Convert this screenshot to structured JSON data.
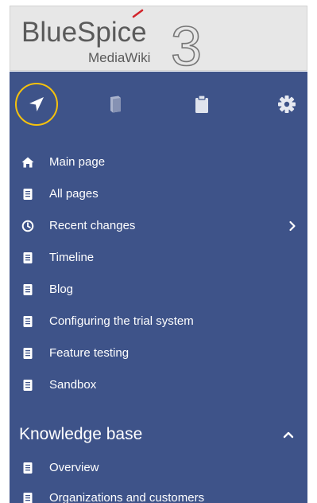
{
  "logo": {
    "brand": "BlueSpice",
    "version": "3",
    "sub": "MediaWiki"
  },
  "tabs": [
    {
      "name": "navigation",
      "icon": "location-arrow-icon",
      "active": true
    },
    {
      "name": "books",
      "icon": "book-icon",
      "active": false
    },
    {
      "name": "clipboard",
      "icon": "clipboard-icon",
      "active": false
    },
    {
      "name": "settings",
      "icon": "gear-icon",
      "active": false
    }
  ],
  "nav": {
    "items": [
      {
        "label": "Main page",
        "icon": "home-icon"
      },
      {
        "label": "All pages",
        "icon": "page-icon"
      },
      {
        "label": "Recent changes",
        "icon": "clock-icon",
        "has_submenu": true
      },
      {
        "label": "Timeline",
        "icon": "page-icon"
      },
      {
        "label": "Blog",
        "icon": "page-icon"
      },
      {
        "label": "Configuring the trial system",
        "icon": "page-icon"
      },
      {
        "label": "Feature testing",
        "icon": "page-icon"
      },
      {
        "label": "Sandbox",
        "icon": "page-icon"
      }
    ]
  },
  "knowledge": {
    "title": "Knowledge base",
    "items": [
      {
        "label": "Overview",
        "icon": "page-icon"
      },
      {
        "label": "Organizations and customers",
        "icon": "page-icon"
      }
    ]
  },
  "colors": {
    "panel": "#3e5389",
    "accent": "#f6c20c",
    "logo_text": "#5a5a5a",
    "logo_bg": "#e7e7e7"
  }
}
